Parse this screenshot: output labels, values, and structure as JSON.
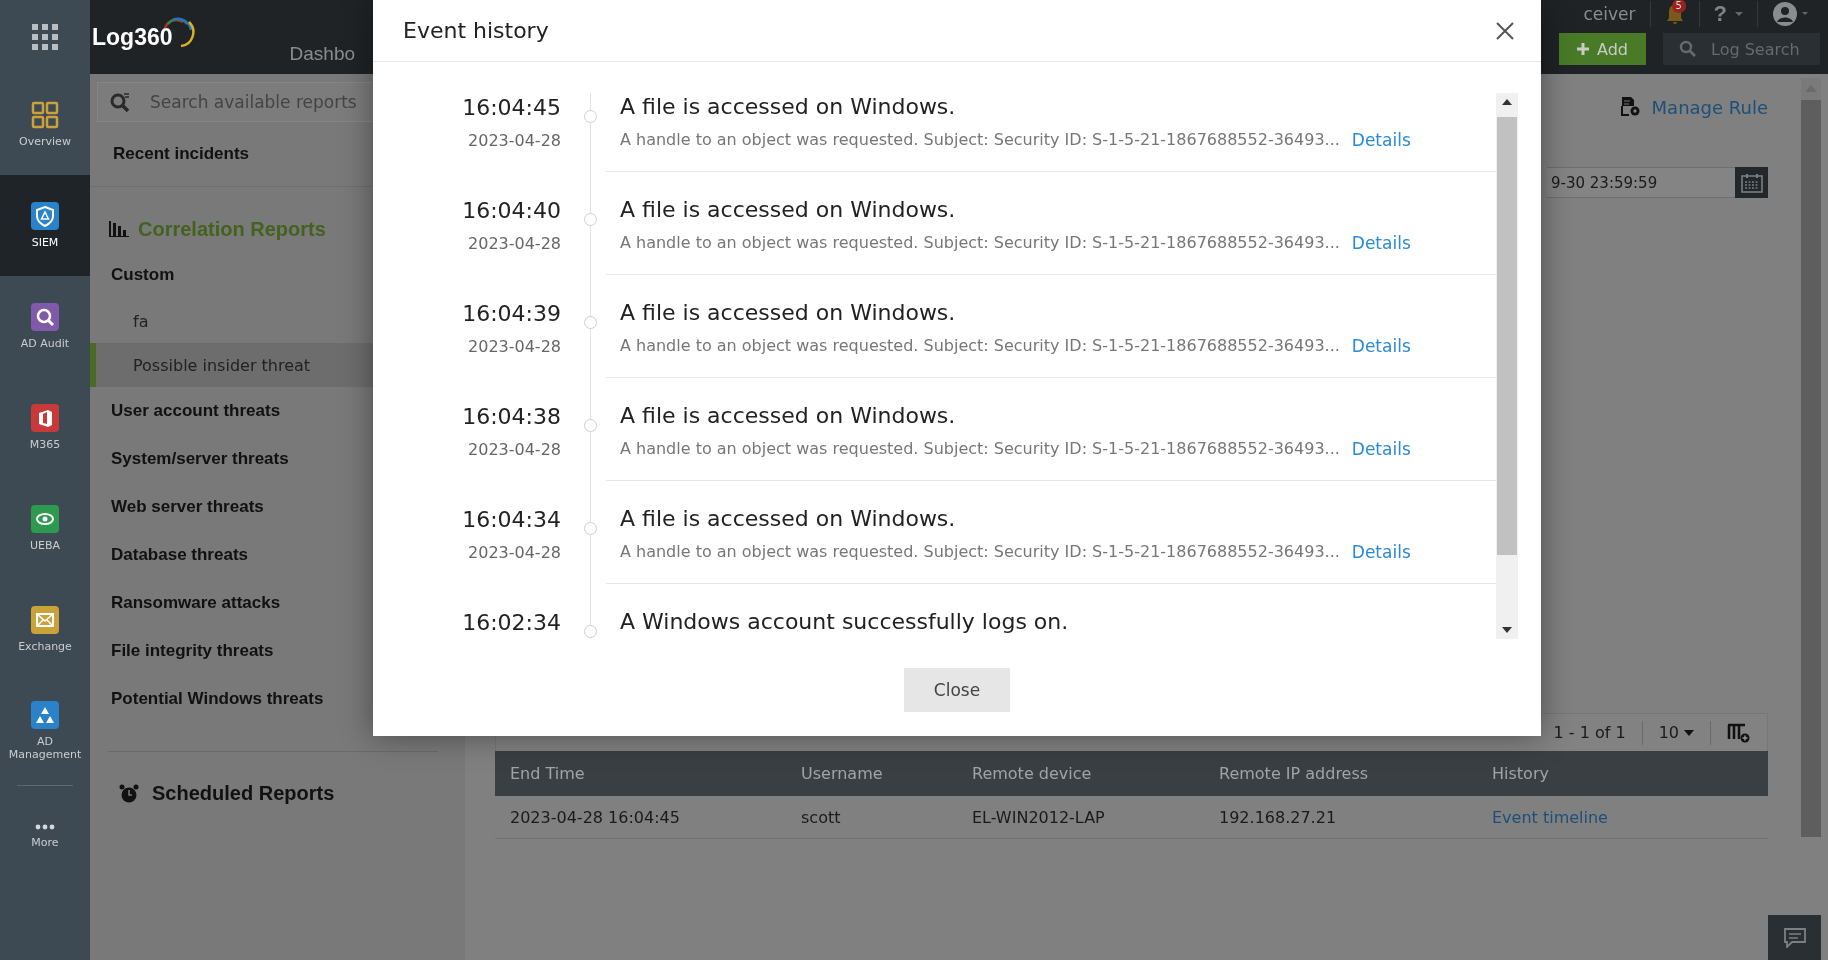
{
  "rail": {
    "items": [
      {
        "label": "Overview",
        "selected": false
      },
      {
        "label": "SIEM",
        "selected": true
      },
      {
        "label": "AD Audit",
        "selected": false
      },
      {
        "label": "M365",
        "selected": false
      },
      {
        "label": "UEBA",
        "selected": false
      },
      {
        "label": "Exchange",
        "selected": false
      },
      {
        "label": "AD Management",
        "selected": false
      }
    ],
    "more": "More"
  },
  "header": {
    "logo": "Log360",
    "tab": "Dashbo",
    "receiver_text": "ceiver",
    "notification_count": "5",
    "help_label": "?",
    "add_button": "Add",
    "log_search": "Log Search"
  },
  "sidebar": {
    "search": {
      "placeholder": "Search available reports"
    },
    "recent": "Recent incidents",
    "correlation_title": "Correlation Reports",
    "items": [
      {
        "label": "Custom",
        "kind": "group",
        "selected": false
      },
      {
        "label": "fa",
        "kind": "child",
        "selected": false
      },
      {
        "label": "Possible insider threat",
        "kind": "child",
        "selected": true
      },
      {
        "label": "User account threats",
        "kind": "group",
        "selected": false
      },
      {
        "label": "System/server threats",
        "kind": "group",
        "selected": false
      },
      {
        "label": "Web server threats",
        "kind": "group",
        "selected": false
      },
      {
        "label": "Database threats",
        "kind": "group",
        "selected": false
      },
      {
        "label": "Ransomware attacks",
        "kind": "group",
        "selected": false
      },
      {
        "label": "File integrity threats",
        "kind": "group",
        "selected": false
      },
      {
        "label": "Potential Windows threats",
        "kind": "group",
        "selected": false
      }
    ],
    "scheduled": "Scheduled Reports"
  },
  "main": {
    "manage_rule": "Manage Rule",
    "date_value": "9-30 23:59:59",
    "pagination": "1 - 1 of 1",
    "page_size": "10",
    "table": {
      "columns": [
        {
          "label": "End Time",
          "kind": "text"
        },
        {
          "label": "Username",
          "kind": "text"
        },
        {
          "label": "Remote device",
          "kind": "text"
        },
        {
          "label": "Remote IP address",
          "kind": "text"
        },
        {
          "label": "History",
          "kind": "link"
        }
      ],
      "rows": [
        {
          "cells": [
            "2023-04-28 16:04:45",
            "scott",
            "EL-WIN2012-LAP",
            "192.168.27.21",
            "Event timeline"
          ]
        }
      ]
    }
  },
  "modal": {
    "title": "Event history",
    "events": [
      {
        "time": "16:04:45",
        "date": "2023-04-28",
        "title": "A file is accessed on Windows.",
        "description": "A handle to an object was requested. Subject: Security ID: S-1-5-21-1867688552-36493...",
        "link": "Details"
      },
      {
        "time": "16:04:40",
        "date": "2023-04-28",
        "title": "A file is accessed on Windows.",
        "description": "A handle to an object was requested. Subject: Security ID: S-1-5-21-1867688552-36493...",
        "link": "Details"
      },
      {
        "time": "16:04:39",
        "date": "2023-04-28",
        "title": "A file is accessed on Windows.",
        "description": "A handle to an object was requested. Subject: Security ID: S-1-5-21-1867688552-36493...",
        "link": "Details"
      },
      {
        "time": "16:04:38",
        "date": "2023-04-28",
        "title": "A file is accessed on Windows.",
        "description": "A handle to an object was requested. Subject: Security ID: S-1-5-21-1867688552-36493...",
        "link": "Details"
      },
      {
        "time": "16:04:34",
        "date": "2023-04-28",
        "title": "A file is accessed on Windows.",
        "description": "A handle to an object was requested. Subject: Security ID: S-1-5-21-1867688552-36493...",
        "link": "Details"
      },
      {
        "time": "16:02:34",
        "title": "A Windows account successfully logs on."
      }
    ],
    "close_button": "Close"
  }
}
